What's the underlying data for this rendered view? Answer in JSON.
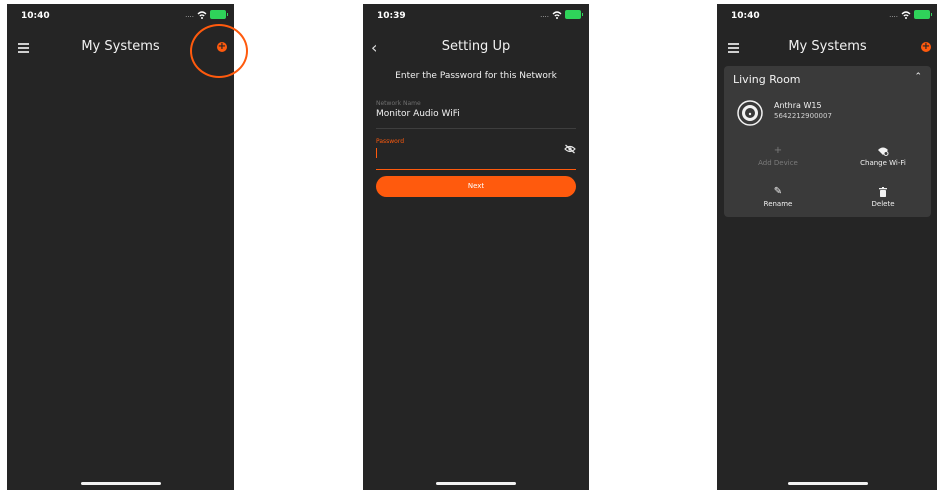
{
  "colors": {
    "accent": "#ff5a0d",
    "background": "#252525",
    "card": "#3a3a3a"
  },
  "screen1": {
    "time": "10:40",
    "title": "My Systems"
  },
  "screen2": {
    "time": "10:39",
    "title": "Setting Up",
    "heading": "Enter the Password for this Network",
    "network_label": "Network Name",
    "network_value": "Monitor Audio WiFi",
    "password_label": "Password",
    "password_value": "",
    "next_label": "Next"
  },
  "screen3": {
    "time": "10:40",
    "title": "My Systems",
    "room": "Living Room",
    "device_name": "Anthra W15",
    "device_serial": "5642212900007",
    "actions": {
      "add": "Add Device",
      "change_wifi": "Change Wi-Fi",
      "rename": "Rename",
      "delete": "Delete"
    }
  }
}
